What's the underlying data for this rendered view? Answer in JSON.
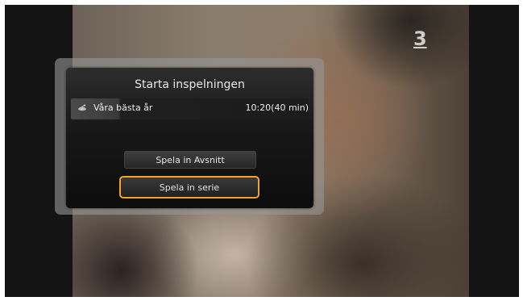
{
  "channel_logo": "3",
  "dialog": {
    "title": "Starta inspelningen",
    "program": {
      "icon": "satellite-dish-icon",
      "name": "Våra bästa år",
      "time": "10:20(40 min)"
    },
    "buttons": {
      "episode": "Spela in Avsnitt",
      "series": "Spela in serie"
    },
    "focus_color": "#f0a42c"
  }
}
